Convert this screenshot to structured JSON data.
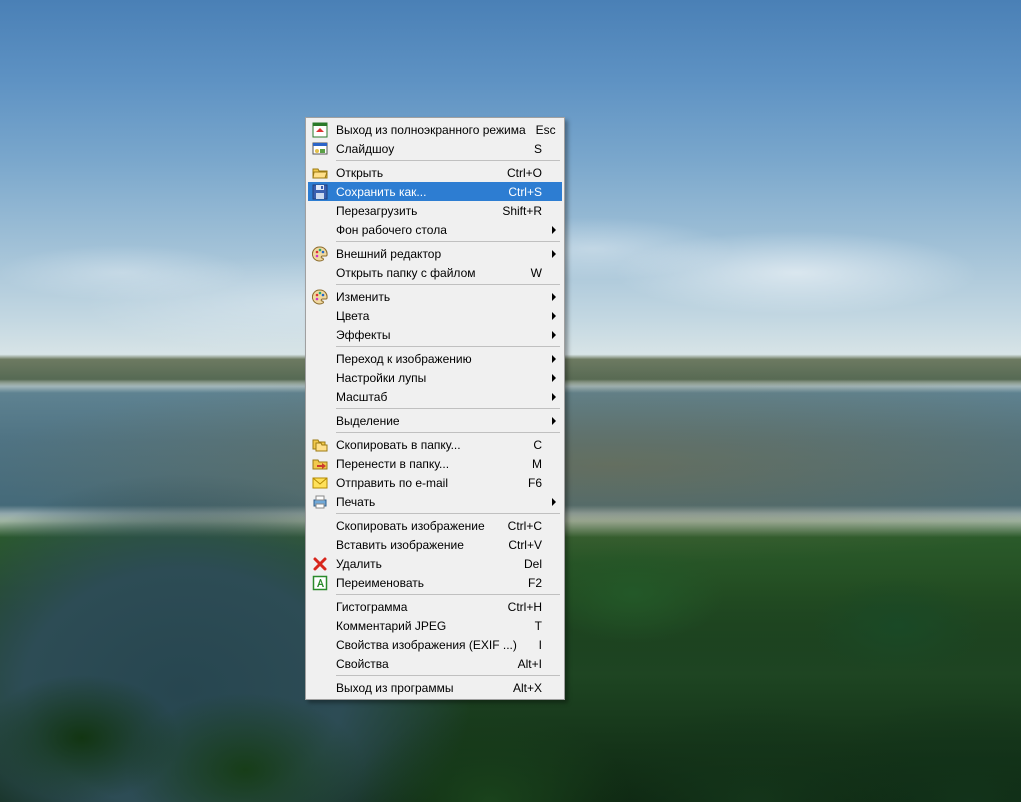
{
  "menu": {
    "groups": [
      [
        {
          "id": "exit-fullscreen",
          "icon": "fullscreen-exit-icon",
          "label": "Выход из полноэкранного режима",
          "shortcut": "Esc",
          "submenu": false
        },
        {
          "id": "slideshow",
          "icon": "slideshow-icon",
          "label": "Слайдшоу",
          "shortcut": "S",
          "submenu": false
        }
      ],
      [
        {
          "id": "open",
          "icon": "folder-open-icon",
          "label": "Открыть",
          "shortcut": "Ctrl+O",
          "submenu": false
        },
        {
          "id": "save-as",
          "icon": "save-icon",
          "label": "Сохранить как...",
          "shortcut": "Ctrl+S",
          "submenu": false,
          "selected": true
        },
        {
          "id": "reload",
          "icon": null,
          "label": "Перезагрузить",
          "shortcut": "Shift+R",
          "submenu": false
        },
        {
          "id": "wallpaper",
          "icon": null,
          "label": "Фон рабочего стола",
          "shortcut": "",
          "submenu": true
        }
      ],
      [
        {
          "id": "external-editor",
          "icon": "palette-icon",
          "label": "Внешний редактор",
          "shortcut": "",
          "submenu": true
        },
        {
          "id": "open-folder",
          "icon": null,
          "label": "Открыть папку с файлом",
          "shortcut": "W",
          "submenu": false
        }
      ],
      [
        {
          "id": "edit",
          "icon": "palette-icon",
          "label": "Изменить",
          "shortcut": "",
          "submenu": true
        },
        {
          "id": "colors",
          "icon": null,
          "label": "Цвета",
          "shortcut": "",
          "submenu": true
        },
        {
          "id": "effects",
          "icon": null,
          "label": "Эффекты",
          "shortcut": "",
          "submenu": true
        }
      ],
      [
        {
          "id": "goto-image",
          "icon": null,
          "label": "Переход к изображению",
          "shortcut": "",
          "submenu": true
        },
        {
          "id": "magnifier",
          "icon": null,
          "label": "Настройки лупы",
          "shortcut": "",
          "submenu": true
        },
        {
          "id": "zoom",
          "icon": null,
          "label": "Масштаб",
          "shortcut": "",
          "submenu": true
        }
      ],
      [
        {
          "id": "selection",
          "icon": null,
          "label": "Выделение",
          "shortcut": "",
          "submenu": true
        }
      ],
      [
        {
          "id": "copy-to-folder",
          "icon": "copy-folder-icon",
          "label": "Скопировать в папку...",
          "shortcut": "C",
          "submenu": false
        },
        {
          "id": "move-to-folder",
          "icon": "move-folder-icon",
          "label": "Перенести в папку...",
          "shortcut": "M",
          "submenu": false
        },
        {
          "id": "send-email",
          "icon": "mail-icon",
          "label": "Отправить по e-mail",
          "shortcut": "F6",
          "submenu": false
        },
        {
          "id": "print",
          "icon": "printer-icon",
          "label": "Печать",
          "shortcut": "",
          "submenu": true
        }
      ],
      [
        {
          "id": "copy-image",
          "icon": null,
          "label": "Скопировать изображение",
          "shortcut": "Ctrl+C",
          "submenu": false
        },
        {
          "id": "paste-image",
          "icon": null,
          "label": "Вставить изображение",
          "shortcut": "Ctrl+V",
          "submenu": false
        },
        {
          "id": "delete",
          "icon": "delete-icon",
          "label": "Удалить",
          "shortcut": "Del",
          "submenu": false
        },
        {
          "id": "rename",
          "icon": "rename-icon",
          "label": "Переименовать",
          "shortcut": "F2",
          "submenu": false
        }
      ],
      [
        {
          "id": "histogram",
          "icon": null,
          "label": "Гистограмма",
          "shortcut": "Ctrl+H",
          "submenu": false
        },
        {
          "id": "jpeg-comment",
          "icon": null,
          "label": "Комментарий JPEG",
          "shortcut": "T",
          "submenu": false
        },
        {
          "id": "image-props",
          "icon": null,
          "label": "Свойства изображения (EXIF ...)",
          "shortcut": "I",
          "submenu": false
        },
        {
          "id": "props",
          "icon": null,
          "label": "Свойства",
          "shortcut": "Alt+I",
          "submenu": false
        }
      ],
      [
        {
          "id": "exit",
          "icon": null,
          "label": "Выход из программы",
          "shortcut": "Alt+X",
          "submenu": false
        }
      ]
    ]
  }
}
